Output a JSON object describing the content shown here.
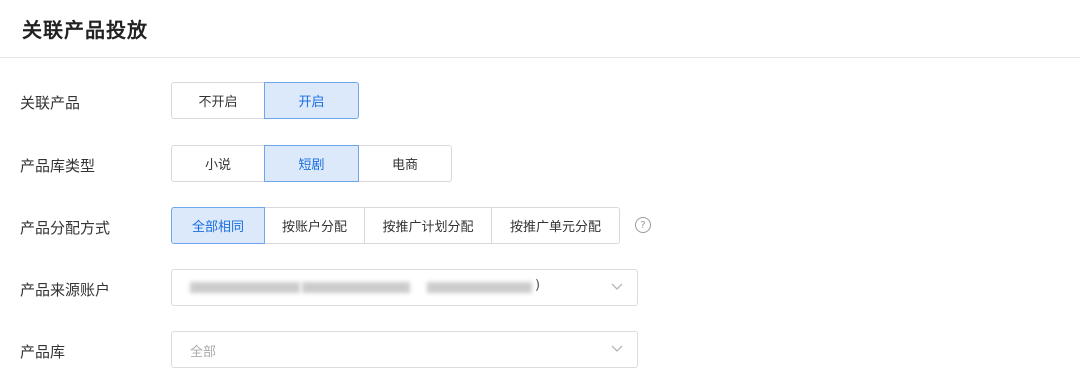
{
  "title": "关联产品投放",
  "rows": {
    "link_product": {
      "label": "关联产品",
      "options": [
        "不开启",
        "开启"
      ],
      "selected": "开启"
    },
    "library_type": {
      "label": "产品库类型",
      "options": [
        "小说",
        "短剧",
        "电商"
      ],
      "selected": "短剧"
    },
    "allocation": {
      "label": "产品分配方式",
      "options": [
        "全部相同",
        "按账户分配",
        "按推广计划分配",
        "按推广单元分配"
      ],
      "selected": "全部相同",
      "help_icon": "question-circle-icon",
      "help_text": "?"
    },
    "source_account": {
      "label": "产品来源账户",
      "value_suffix": ")"
    },
    "library": {
      "label": "产品库",
      "value": "全部"
    }
  },
  "colors": {
    "accent": "#1a6ee0",
    "active_bg": "#dbe9fb",
    "active_border": "#6fa6ee",
    "border": "#d9d9d9"
  }
}
